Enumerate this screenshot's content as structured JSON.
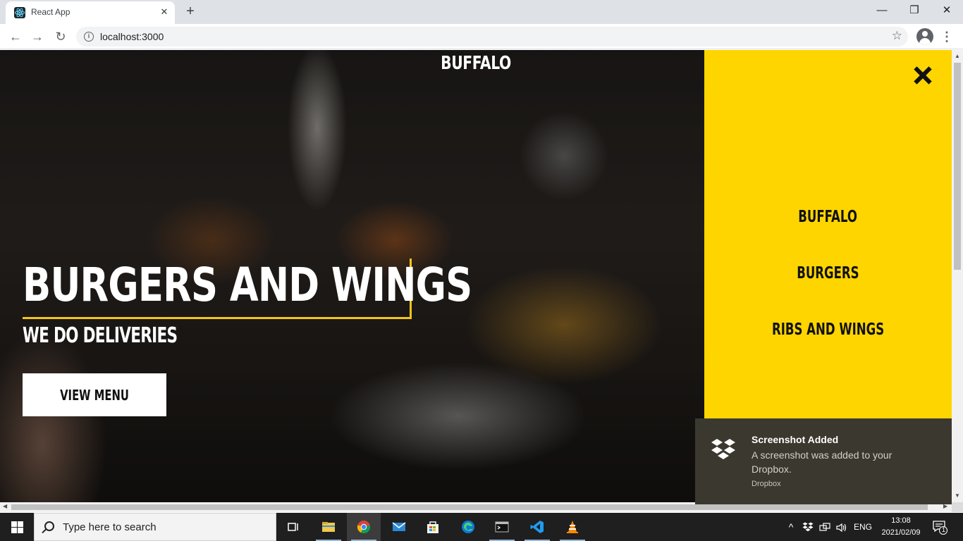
{
  "browser": {
    "tab_title": "React App",
    "tab_close": "✕",
    "new_tab": "+",
    "window_controls": {
      "minimize": "—",
      "restore": "❐",
      "close": "✕"
    },
    "nav": {
      "back": "←",
      "forward": "→",
      "reload": "↻"
    },
    "url": "localhost:3000",
    "info_icon_glyph": "i",
    "bookmark_glyph": "☆",
    "menu_glyph": "⋮"
  },
  "page": {
    "brand": "BUFFALO",
    "headline": "BURGERS AND WINGS",
    "subheadline": "WE DO DELIVERIES",
    "cta_label": "VIEW MENU",
    "accent_color": "#f5c518"
  },
  "side_menu": {
    "background": "#ffd500",
    "items": [
      {
        "label": "BUFFALO"
      },
      {
        "label": "BURGERS"
      },
      {
        "label": "RIBS AND WINGS"
      }
    ]
  },
  "toast": {
    "title": "Screenshot Added",
    "body": "A screenshot was added to your Dropbox.",
    "app": "Dropbox",
    "icon": "dropbox-icon"
  },
  "taskbar": {
    "search_placeholder": "Type here to search",
    "apps": [
      "task-view-icon",
      "file-explorer-icon",
      "chrome-icon",
      "mail-icon",
      "store-icon",
      "edge-icon",
      "terminal-icon",
      "vscode-icon",
      "vlc-icon"
    ],
    "tray": {
      "chevron": "^",
      "language": "ENG"
    },
    "time": "13:08",
    "date": "2021/02/09",
    "notification_count": "1"
  }
}
